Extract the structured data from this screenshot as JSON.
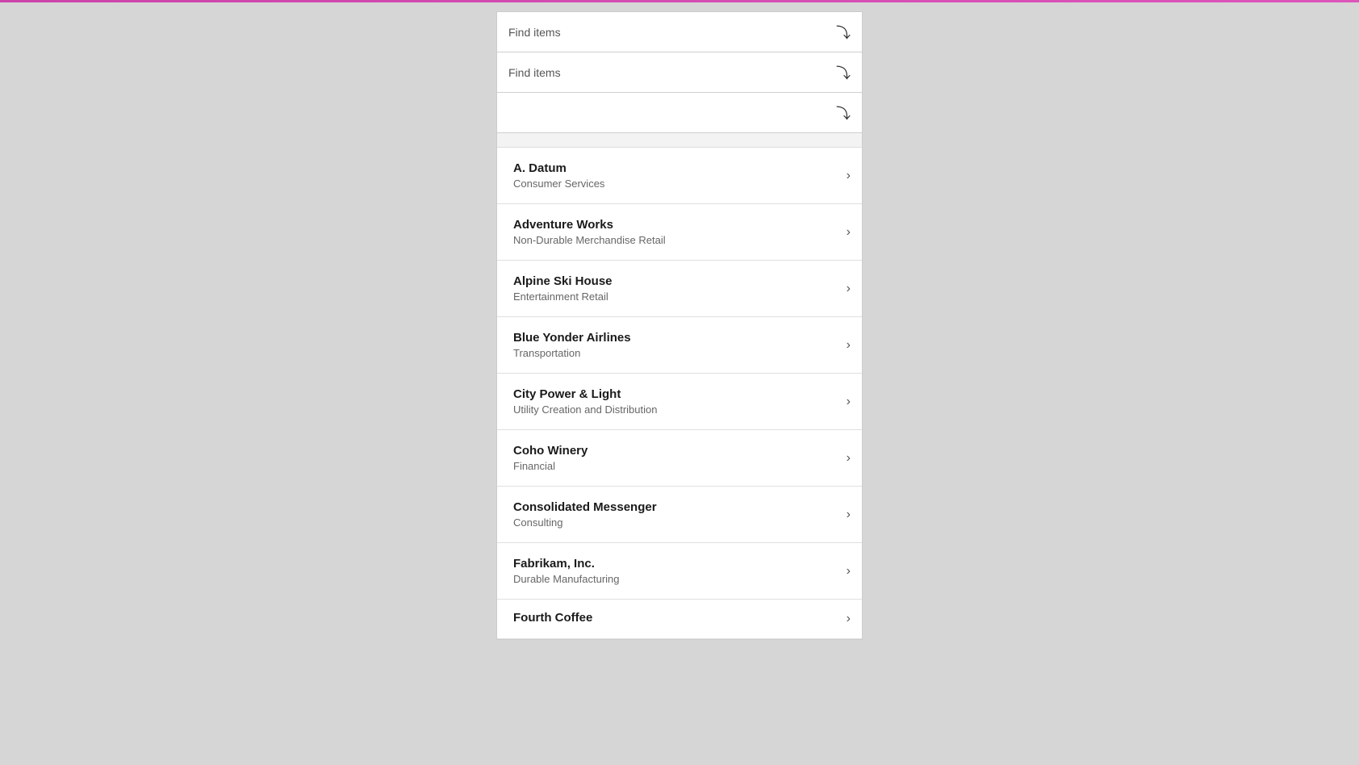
{
  "topbar": {
    "visible": true
  },
  "filters": [
    {
      "id": "filter1",
      "label": "Find items",
      "hasLabel": true
    },
    {
      "id": "filter2",
      "label": "Find items",
      "hasLabel": true
    },
    {
      "id": "filter3",
      "label": "",
      "hasLabel": false
    }
  ],
  "items": [
    {
      "id": "a-datum",
      "name": "A. Datum",
      "subtitle": "Consumer Services"
    },
    {
      "id": "adventure-works",
      "name": "Adventure Works",
      "subtitle": "Non-Durable Merchandise Retail"
    },
    {
      "id": "alpine-ski-house",
      "name": "Alpine Ski House",
      "subtitle": "Entertainment Retail"
    },
    {
      "id": "blue-yonder-airlines",
      "name": "Blue Yonder Airlines",
      "subtitle": "Transportation"
    },
    {
      "id": "city-power-light",
      "name": "City Power & Light",
      "subtitle": "Utility Creation and Distribution"
    },
    {
      "id": "coho-winery",
      "name": "Coho Winery",
      "subtitle": "Financial"
    },
    {
      "id": "consolidated-messenger",
      "name": "Consolidated Messenger",
      "subtitle": "Consulting"
    },
    {
      "id": "fabrikam-inc",
      "name": "Fabrikam, Inc.",
      "subtitle": "Durable Manufacturing"
    },
    {
      "id": "fourth-coffee",
      "name": "Fourth Coffee",
      "subtitle": ""
    }
  ],
  "icons": {
    "chevron_down": "⌵",
    "chevron_right": "›"
  }
}
